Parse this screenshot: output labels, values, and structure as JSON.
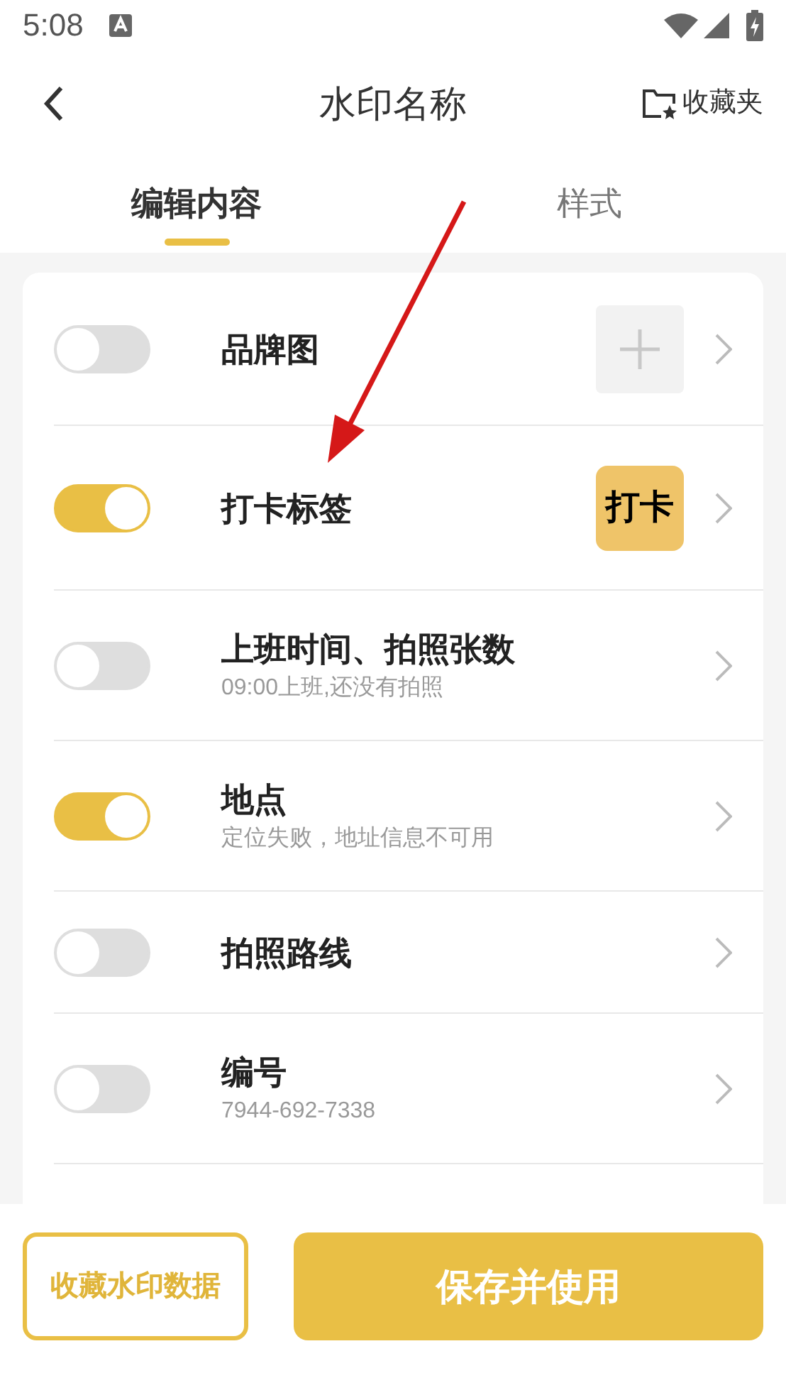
{
  "status_bar": {
    "time": "5:08"
  },
  "header": {
    "title": "水印名称",
    "favorites": "收藏夹"
  },
  "tabs": [
    {
      "label": "编辑内容",
      "selected": true
    },
    {
      "label": "样式",
      "selected": false
    }
  ],
  "items": [
    {
      "title": "品牌图",
      "on": false,
      "trailing": {
        "kind": "add"
      }
    },
    {
      "title": "打卡标签",
      "on": true,
      "trailing": {
        "kind": "badge",
        "text": "打卡"
      }
    },
    {
      "title": "上班时间、拍照张数",
      "subtitle": "09:00上班,还没有拍照",
      "on": false
    },
    {
      "title": "地点",
      "subtitle": "定位失败，地址信息不可用",
      "on": true
    },
    {
      "title": "拍照路线",
      "on": false
    },
    {
      "title": "编号",
      "subtitle": "7944-692-7338",
      "on": false
    }
  ],
  "buttons": {
    "secondary": "收藏水印数据",
    "primary": "保存并使用"
  },
  "annotation": {
    "kind": "arrow"
  }
}
